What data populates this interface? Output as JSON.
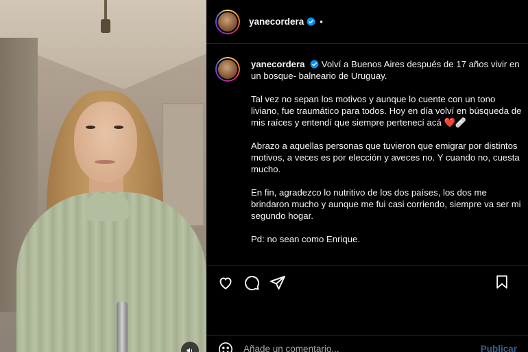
{
  "post": {
    "username": "yanecordera",
    "header_separator": "•",
    "caption_paragraphs": [
      "Volví a Buenos Aires después de 17 años vivir en un bosque- balneario de Uruguay.",
      "Tal vez no sepan los motivos y aunque lo cuente con un tono liviano, fue traumático para todos. Hoy en día volví en búsqueda de mis raíces y entendí que siempre pertenecí acá ❤️🩹",
      "Abrazo a aquellas personas que tuvieron que emigrar por distintos motivos, a veces es por elección y aveces no. Y cuando no, cuesta mucho.",
      "En fin, agradezco lo nutritivo de los dos países, los dos me brindaron mucho y aunque me fui casi corriendo, siempre va ser mi segundo hogar.",
      "Pd: no sean como Enrique."
    ]
  },
  "actions": {
    "like_icon": "heart-icon",
    "comment_icon": "comment-icon",
    "share_icon": "share-icon",
    "save_icon": "bookmark-icon"
  },
  "comment_bar": {
    "placeholder": "Añade un comentario...",
    "publish_label": "Publicar"
  },
  "media": {
    "sound_icon": "speaker-icon"
  },
  "colors": {
    "background": "#000000",
    "text": "#f5f5f5",
    "verified": "#0095f6",
    "publish_disabled": "#3a5f8a",
    "divider": "#262626"
  }
}
